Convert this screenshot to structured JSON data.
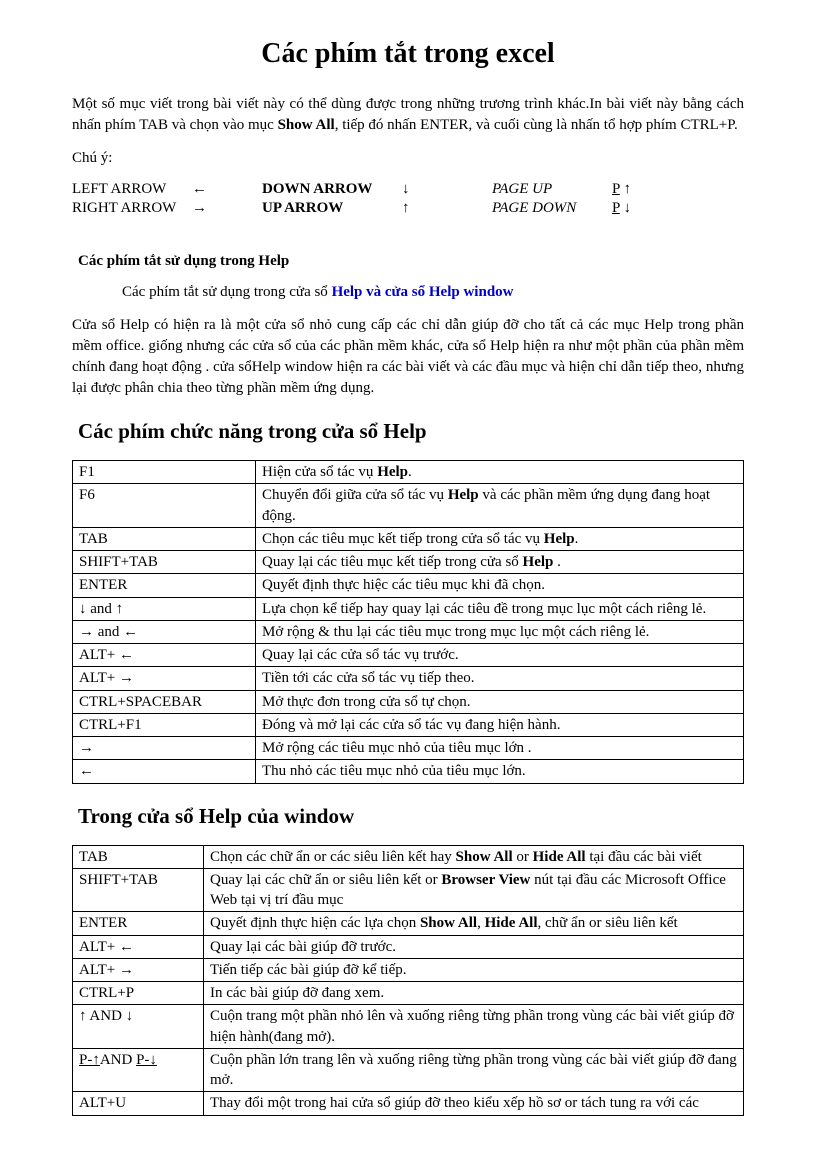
{
  "title": "Các phím tắt trong excel",
  "intro_p1_a": "Một số mục viết trong bài viết này có thể dùng được trong những trương trình khác.In bài viết này bằng cách nhấn phím TAB  và chọn vào mục ",
  "intro_p1_bold": "Show All",
  "intro_p1_b": ", tiếp đó nhấn ENTER, và cuối cùng là nhấn tổ hợp phím CTRL+P.",
  "note_label": "Chú ý:",
  "arrow_keys": {
    "row1": {
      "c1": "LEFT ARROW",
      "c2": "←",
      "c3": "DOWN ARROW",
      "c4": "↓",
      "c5": "PAGE UP",
      "c6a": "P",
      "c6b": " ↑"
    },
    "row2": {
      "c1": "RIGHT ARROW",
      "c2": "→",
      "c3": "UP ARROW",
      "c4": "↑",
      "c5": "PAGE DOWN",
      "c6a": "P",
      "c6b": " ↓"
    }
  },
  "help_section_title": "Các phím tắt sử dụng trong Help",
  "help_sub_a": "Các phím tắt sử dụng trong cửa sổ ",
  "help_sub_link": "Help và cửa sổ Help window",
  "help_para": "Cửa sổ Help có hiện ra là một cửa sổ nhỏ cung cấp các chỉ dẫn giúp đỡ cho tất cả các mục Help trong phần mềm office.  giống nhưng các cửa sổ của các phần mềm khác, cửa sổ Help hiện ra như một phần của phần mềm chính đang hoạt động . cửa sổHelp window hiện ra các bài viết và các đầu mục và hiện chỉ dẫn tiếp theo, nhưng lại được phân chia theo từng phần mềm ứng dụng.",
  "func_keys_title": "Các phím chức năng trong cửa sổ Help",
  "table1": [
    {
      "k": "F1",
      "pre": " Hiện cửa sổ tác vụ ",
      "b": "Help",
      "post": "."
    },
    {
      "k": "F6",
      "pre": "Chuyển đổi giữa cửa sổ tác vụ ",
      "b": "Help",
      "post": " và các phần mềm ứng dụng đang hoạt động."
    },
    {
      "k": "TAB",
      "pre": " Chọn các tiêu mục kết tiếp trong cửa sổ tác vụ ",
      "b": "Help",
      "post": "."
    },
    {
      "k": "SHIFT+TAB",
      "pre": "Quay lại các tiêu mục kết tiếp trong cửa sổ ",
      "b": "Help",
      "post": " ."
    },
    {
      "k": "ENTER",
      "pre": "Quyết định thực hiệc các tiêu mục khi đã chọn.",
      "b": "",
      "post": ""
    },
    {
      "k": "↓ and ↑",
      "pre": "Lựa chọn kể tiếp hay quay lại các tiêu đề trong mục lục một cách riêng lẻ.",
      "b": "",
      "post": ""
    },
    {
      "k": "→ and ←",
      "pre": "Mở rộng & thu lại các tiêu mục trong mục lục một cách riêng lẻ.",
      "b": "",
      "post": ""
    },
    {
      "k": "ALT+ ←",
      "pre": "Quay lại các cửa sổ tác vụ trước.",
      "b": "",
      "post": ""
    },
    {
      "k": "ALT+ →",
      "pre": "Tiền tới các cửa sổ tác vụ tiếp theo.",
      "b": "",
      "post": ""
    },
    {
      "k": "CTRL+SPACEBAR",
      "pre": "Mở thực đơn trong cửa sổ tự chọn.",
      "b": "",
      "post": ""
    },
    {
      "k": "CTRL+F1",
      "pre": "Đóng và mở lại các cửa sổ tác vụ đang hiện hành.",
      "b": "",
      "post": ""
    },
    {
      "k": "→",
      "pre": "Mở rộng các tiêu mục nhỏ của tiêu mục lớn .",
      "b": "",
      "post": ""
    },
    {
      "k": "←",
      "pre": "Thu nhỏ các tiêu mục nhỏ của tiêu mục lớn.",
      "b": "",
      "post": ""
    }
  ],
  "help_window_title": "Trong cửa sổ Help của window",
  "table2": {
    "r1": {
      "k": "TAB",
      "a": "Chọn các chữ ẩn or các siêu liên kết hay ",
      "b1": "Show All",
      "mid": " or ",
      "b2": "Hide All",
      "post": " tại đầu các bài viết"
    },
    "r2": {
      "k": "SHIFT+TAB",
      "a": "Quay lại các chữ ẩn or siêu liên kết or ",
      "b1": "Browser View",
      "post": " nút tại đầu các Microsoft Office Web tại vị trí đầu mục"
    },
    "r3": {
      "k": "ENTER",
      "a": "Quyết định thực hiện các lựa chọn ",
      "b1": "Show All",
      "mid": ", ",
      "b2": "Hide All",
      "post": ", chữ ẩn or siêu liên kết"
    },
    "r4": {
      "k": "ALT+ ←",
      "a": "Quay lại các bài giúp đỡ trước."
    },
    "r5": {
      "k": "ALT+ →",
      "a": "Tiến tiếp các bài giúp đỡ kể tiếp."
    },
    "r6": {
      "k": "CTRL+P",
      "a": "In các bài giúp đỡ đang xem."
    },
    "r7": {
      "k": "↑ AND ↓",
      "a": "Cuộn trang một phần nhỏ lên và xuống riêng từng phần trong vùng  các bài viết giúp đỡ hiện hành(đang mở)."
    },
    "r8": {
      "k1u": "P-↑",
      "kmid": "AND ",
      "k2u": "P-↓",
      "a": "Cuộn phần lớn trang lên và xuống riêng từng phần trong vùng  các bài viết giúp đỡ đang mở."
    },
    "r9": {
      "k": "ALT+U",
      "a": "Thay đổi một trong hai cửa sổ giúp đỡ theo kiểu xếp hồ sơ or tách tung ra với các"
    }
  }
}
